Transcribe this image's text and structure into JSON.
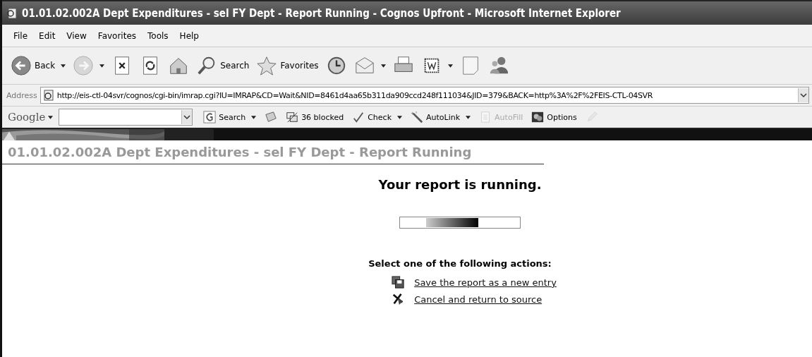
{
  "window": {
    "title": "01.01.02.002A Dept Expenditures - sel FY Dept - Report Running - Cognos Upfront - Microsoft Internet Explorer"
  },
  "menu": [
    "File",
    "Edit",
    "View",
    "Favorites",
    "Tools",
    "Help"
  ],
  "toolbar": [
    {
      "kind": "back",
      "label": "Back",
      "dropdown": true,
      "disabled": false
    },
    {
      "kind": "forward",
      "dropdown": true,
      "disabled": true
    },
    {
      "kind": "stop",
      "dropdown": false,
      "disabled": false
    },
    {
      "kind": "refresh",
      "dropdown": false,
      "disabled": false
    },
    {
      "kind": "home",
      "dropdown": false,
      "disabled": false
    },
    {
      "kind": "search",
      "label": "Search",
      "dropdown": false,
      "disabled": false
    },
    {
      "kind": "favorites",
      "label": "Favorites",
      "dropdown": false,
      "disabled": false
    },
    {
      "kind": "history",
      "dropdown": false,
      "disabled": false
    },
    {
      "kind": "mail",
      "dropdown": true,
      "disabled": false
    },
    {
      "kind": "print",
      "dropdown": false,
      "disabled": false
    },
    {
      "kind": "edit",
      "dropdown": true,
      "disabled": false
    },
    {
      "kind": "note",
      "dropdown": false,
      "disabled": false
    },
    {
      "kind": "messenger",
      "dropdown": false,
      "disabled": false
    }
  ],
  "address": {
    "label": "Address",
    "value": "http://eis-ctl-04svr/cognos/cgi-bin/imrap.cgi?IU=IMRAP&CD=Wait&NID=8461d4aa65b311da909ccd248f111034&JID=379&BACK=http%3A%2F%2FEIS-CTL-04SVR"
  },
  "google_bar": {
    "logo": "Google",
    "items": [
      {
        "kind": "search",
        "label": "Search",
        "dropdown": true,
        "disabled": false
      },
      {
        "kind": "news",
        "dropdown": false,
        "disabled": false
      },
      {
        "kind": "blocked",
        "label": "36 blocked",
        "dropdown": false,
        "disabled": false
      },
      {
        "kind": "check",
        "label": "Check",
        "dropdown": true,
        "disabled": false
      },
      {
        "kind": "autolink",
        "label": "AutoLink",
        "dropdown": true,
        "disabled": false
      },
      {
        "kind": "autofill",
        "label": "AutoFill",
        "dropdown": false,
        "disabled": true
      },
      {
        "kind": "options",
        "label": "Options",
        "dropdown": false,
        "disabled": false
      },
      {
        "kind": "pencil",
        "dropdown": false,
        "disabled": true
      }
    ]
  },
  "page": {
    "title": "01.01.02.002A Dept Expenditures - sel FY Dept - Report Running",
    "heading": "Your report is running.",
    "prompt": "Select one of the following actions:",
    "actions": [
      {
        "kind": "save",
        "label": "Save the report as a new entry"
      },
      {
        "kind": "cancel",
        "label": "Cancel and return to source"
      }
    ]
  }
}
